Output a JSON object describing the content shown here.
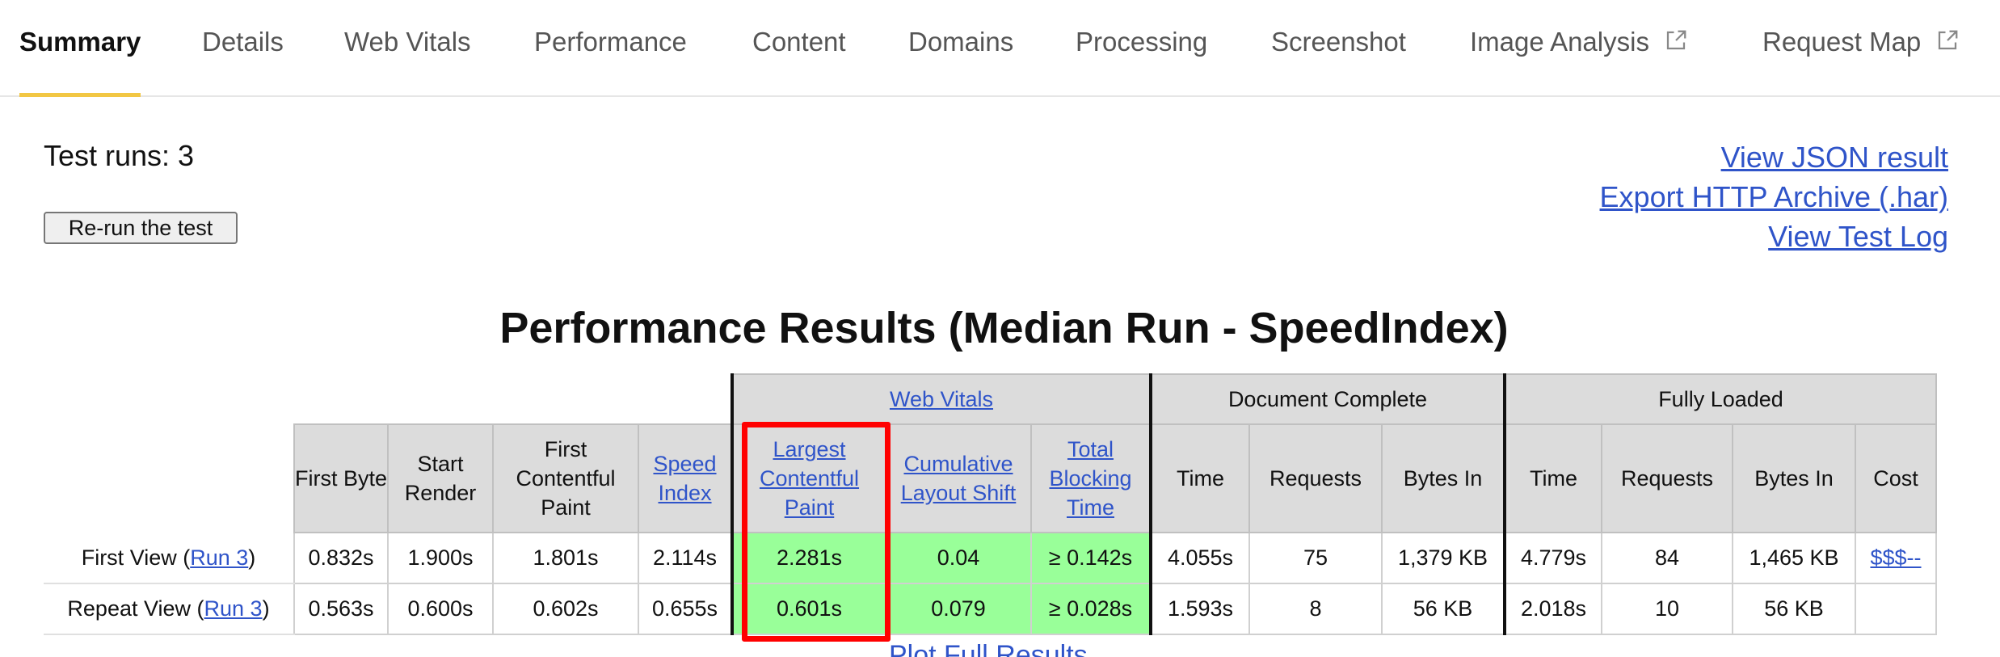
{
  "tabs": [
    {
      "label": "Summary",
      "active": true
    },
    {
      "label": "Details"
    },
    {
      "label": "Web Vitals"
    },
    {
      "label": "Performance"
    },
    {
      "label": "Content"
    },
    {
      "label": "Domains"
    },
    {
      "label": "Processing"
    },
    {
      "label": "Screenshot"
    },
    {
      "label": "Image Analysis",
      "external": true
    },
    {
      "label": "Request Map",
      "external": true
    }
  ],
  "summary": {
    "test_runs": "Test runs: 3",
    "rerun_label": "Re-run the test",
    "links": {
      "json": "View JSON result",
      "har": "Export HTTP Archive (.har)",
      "log": "View Test Log"
    },
    "results_title": "Performance Results (Median Run - SpeedIndex)",
    "plot_link": "Plot Full Results"
  },
  "table": {
    "groups": {
      "web_vitals": "Web Vitals",
      "document_complete": "Document Complete",
      "fully_loaded": "Fully Loaded"
    },
    "columns": {
      "first_byte": "First Byte",
      "start_render": "Start Render",
      "fcp": "First Contentful Paint",
      "speed_index": "Speed Index",
      "lcp": "Largest Contentful Paint",
      "cls": "Cumulative Layout Shift",
      "tbt": "Total Blocking Time",
      "dc_time": "Time",
      "dc_requests": "Requests",
      "dc_bytes": "Bytes In",
      "fl_time": "Time",
      "fl_requests": "Requests",
      "fl_bytes": "Bytes In",
      "cost": "Cost"
    },
    "rows": [
      {
        "label": "First View (",
        "run_link": "Run 3",
        "close": ")",
        "first_byte": "0.832s",
        "start_render": "1.900s",
        "fcp": "1.801s",
        "speed_index": "2.114s",
        "lcp": "2.281s",
        "cls": "0.04",
        "tbt": "≥ 0.142s",
        "dc_time": "4.055s",
        "dc_requests": "75",
        "dc_bytes": "1,379 KB",
        "fl_time": "4.779s",
        "fl_requests": "84",
        "fl_bytes": "1,465 KB",
        "cost": "$$$--"
      },
      {
        "label": "Repeat View (",
        "run_link": "Run 3",
        "close": ")",
        "first_byte": "0.563s",
        "start_render": "0.600s",
        "fcp": "0.602s",
        "speed_index": "0.655s",
        "lcp": "0.601s",
        "cls": "0.079",
        "tbt": "≥ 0.028s",
        "dc_time": "1.593s",
        "dc_requests": "8",
        "dc_bytes": "56 KB",
        "fl_time": "2.018s",
        "fl_requests": "10",
        "fl_bytes": "56 KB",
        "cost": ""
      }
    ]
  },
  "colors": {
    "link": "#2f54c9",
    "vital_good": "#99ff99",
    "active_tab_underline": "#f2c744",
    "highlight_box": "#ff0000",
    "header_bg": "#dcdcdc"
  }
}
